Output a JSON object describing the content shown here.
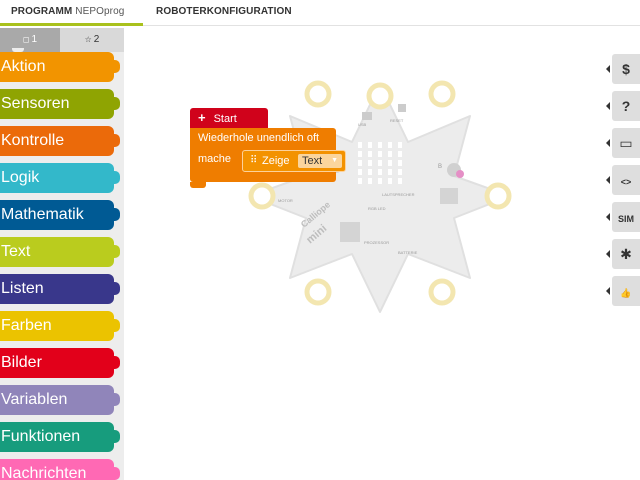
{
  "tabs": {
    "program_prefix": "PROGRAMM",
    "program_name": "NEPOprog",
    "robot_config": "ROBOTERKONFIGURATION"
  },
  "toolbox": {
    "levels": [
      {
        "label": "1",
        "icon": "square-icon"
      },
      {
        "label": "2",
        "icon": "star-icon"
      }
    ],
    "categories": [
      {
        "label": "Aktion",
        "color": "#f29400"
      },
      {
        "label": "Sensoren",
        "color": "#8fa402"
      },
      {
        "label": "Kontrolle",
        "color": "#eb6a0a"
      },
      {
        "label": "Logik",
        "color": "#33b8ca"
      },
      {
        "label": "Mathematik",
        "color": "#005a94"
      },
      {
        "label": "Text",
        "color": "#bacc1e"
      },
      {
        "label": "Listen",
        "color": "#39378b"
      },
      {
        "label": "Farben",
        "color": "#ebc300"
      },
      {
        "label": "Bilder",
        "color": "#e2001a"
      },
      {
        "label": "Variablen",
        "color": "#9085ba"
      },
      {
        "label": "Funktionen",
        "color": "#179c7d"
      },
      {
        "label": "Nachrichten",
        "color": "#ff69b4"
      }
    ]
  },
  "board": {
    "labels": {
      "usb": "USB",
      "reset": "RESET",
      "loudspeaker": "LAUTSPRECHER",
      "motor": "MOTOR",
      "rgb_led": "RGB LED",
      "processor": "PROZESSOR",
      "battery": "BATTERIE",
      "brand": "Calliope",
      "brand_sub": "mini",
      "button_a": "A",
      "button_b": "B"
    },
    "color": "#ececec"
  },
  "blocks": {
    "start": "Start",
    "loop": "Wiederhole unendlich oft",
    "do": "mache",
    "show": "Zeige",
    "show_value": "Text"
  },
  "right_toolbar": [
    {
      "icon": "dollar-icon",
      "glyph": "$"
    },
    {
      "icon": "help-icon",
      "glyph": "?"
    },
    {
      "icon": "comment-icon",
      "glyph": "▭"
    },
    {
      "icon": "code-icon",
      "glyph": "<>"
    },
    {
      "icon": "sim-icon",
      "glyph": "SIM"
    },
    {
      "icon": "bug-icon",
      "glyph": "✱"
    },
    {
      "icon": "thumbs-up-icon",
      "glyph": "👍"
    }
  ]
}
